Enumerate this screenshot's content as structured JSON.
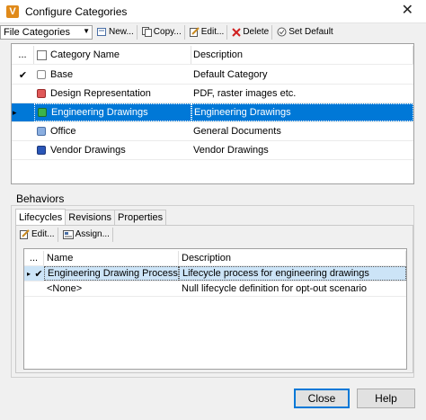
{
  "window": {
    "title": "Configure Categories",
    "app_icon_letter": "V"
  },
  "toolbar": {
    "category_type": "File Categories",
    "new_label": "New...",
    "copy_label": "Copy...",
    "edit_label": "Edit...",
    "delete_label": "Delete",
    "set_default_label": "Set Default"
  },
  "categories": {
    "header_marker": "...",
    "col_name": "Category Name",
    "col_desc": "Description",
    "rows": [
      {
        "marker": "✔",
        "name": "Base",
        "desc": "Default Category",
        "color": "#ffffff"
      },
      {
        "marker": "",
        "name": "Design Representation",
        "desc": "PDF, raster images etc.",
        "color": "#e05858"
      },
      {
        "marker": "▸",
        "name": "Engineering Drawings",
        "desc": "Engineering Drawings",
        "color": "#3cb44b"
      },
      {
        "marker": "",
        "name": "Office",
        "desc": "General Documents",
        "color": "#8aaee0"
      },
      {
        "marker": "",
        "name": "Vendor Drawings",
        "desc": "Vendor Drawings",
        "color": "#2a56b8"
      }
    ]
  },
  "behaviors": {
    "label": "Behaviors",
    "tabs": [
      "Lifecycles",
      "Revisions",
      "Properties"
    ],
    "edit_label": "Edit...",
    "assign_label": "Assign...",
    "header_marker": "...",
    "col_name": "Name",
    "col_desc": "Description",
    "rows": [
      {
        "marker": "▸",
        "check": "✔",
        "name": "Engineering Drawing Process",
        "desc": "Lifecycle process for engineering drawings"
      },
      {
        "marker": "",
        "check": "",
        "name": "<None>",
        "desc": "Null lifecycle definition for opt-out scenario"
      }
    ]
  },
  "buttons": {
    "close": "Close",
    "help": "Help"
  }
}
